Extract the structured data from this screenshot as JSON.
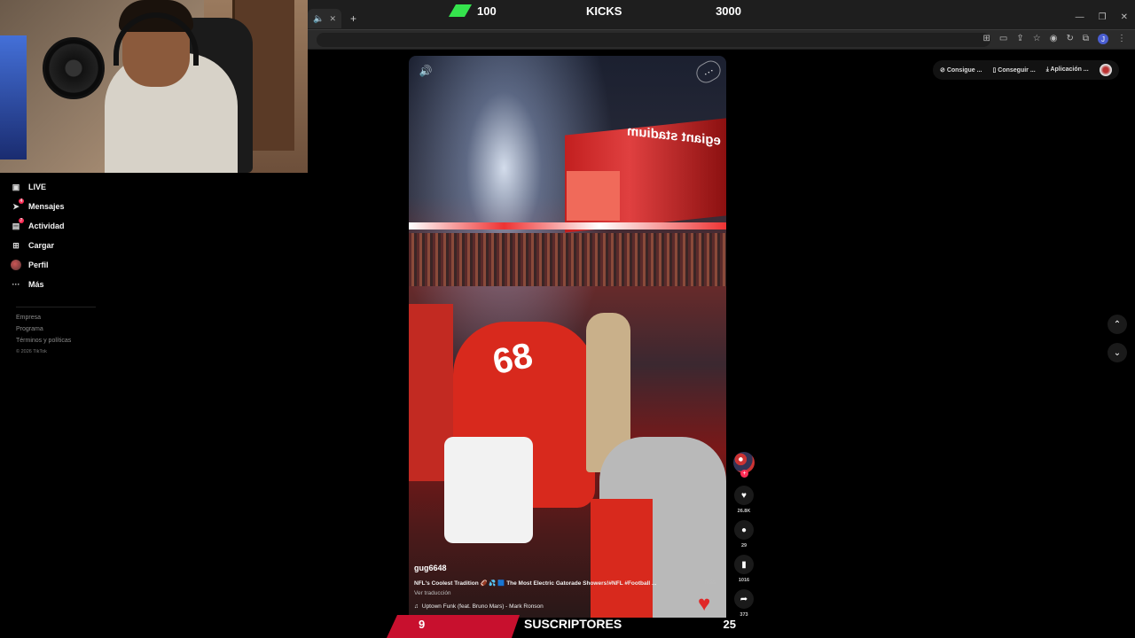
{
  "kicks": {
    "current": "100",
    "label": "KICKS",
    "goal": "3000"
  },
  "subs": {
    "current": "9",
    "label": "SUSCRIPTORES",
    "goal": "25"
  },
  "sidebar": {
    "items": [
      {
        "label": "LIVE",
        "icon": "live-tv-icon"
      },
      {
        "label": "Mensajes",
        "icon": "send-icon",
        "badge": "4"
      },
      {
        "label": "Actividad",
        "icon": "activity-icon",
        "badge": "7"
      },
      {
        "label": "Cargar",
        "icon": "upload-icon"
      },
      {
        "label": "Perfil",
        "icon": "profile-avatar"
      },
      {
        "label": "Más",
        "icon": "more-icon"
      }
    ],
    "footer": [
      "Empresa",
      "Programa",
      "Términos y políticas"
    ],
    "copyright": "© 2026 TikTok"
  },
  "top_actions": [
    "Consigue ...",
    "Conseguir ...",
    "Aplicación ..."
  ],
  "video": {
    "stadium_text": "egiant stadium",
    "username": "gug6648",
    "description": "NFL's Coolest Tradition 🏈 💦 🟦 The Most Electric Gatorade Showers!#NFL #Football ...",
    "more_label": "más",
    "translate_label": "Ver traducción",
    "music": "Uptown Funk (feat. Bruno Mars) - Mark Ronson"
  },
  "rail": {
    "likes": "26.8K",
    "comments": "29",
    "saves": "1016",
    "shares": "373"
  },
  "colors": {
    "accent": "#fe2c55",
    "kicks_green": "#35e34d",
    "sub_red": "#c8102e"
  }
}
